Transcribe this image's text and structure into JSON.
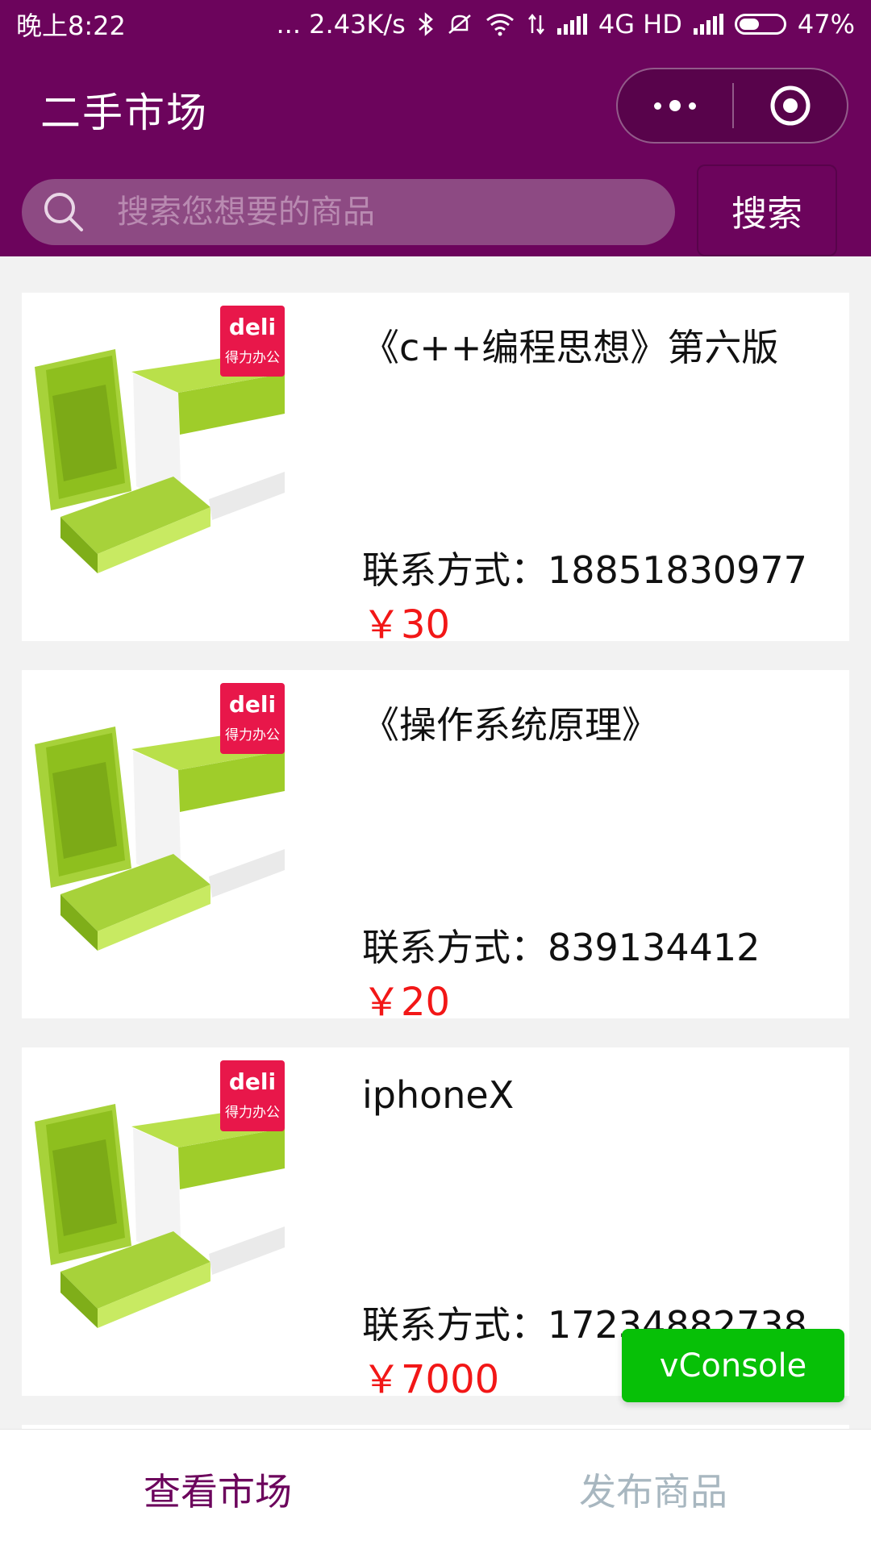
{
  "status_bar": {
    "time": "晚上8:22",
    "net_speed": "... 2.43K/s",
    "network_label": "4G HD",
    "battery": "47%",
    "battery_level": 0.47
  },
  "header": {
    "title": "二手市场",
    "search": {
      "placeholder": "搜索您想要的商品",
      "button_label": "搜索"
    }
  },
  "products": [
    {
      "title": "《c++编程思想》第六版",
      "contact": "联系方式：18851830977",
      "price": "￥30",
      "image": "deli-a4-paper-product-photo"
    },
    {
      "title": "《操作系统原理》",
      "contact": "联系方式：839134412",
      "price": "￥20",
      "image": "deli-a4-paper-product-photo"
    },
    {
      "title": "iphoneX",
      "contact": "联系方式：17234882738",
      "price": "￥7000",
      "image": "deli-a4-paper-product-photo"
    }
  ],
  "brand_badge": {
    "line1": "deli",
    "line2": "得力办公",
    "color": "#e8174a"
  },
  "vconsole_label": "vConsole",
  "tabs": [
    {
      "label": "查看市场",
      "active": true
    },
    {
      "label": "发布商品",
      "active": false
    }
  ],
  "colors": {
    "brand": "#6c045c",
    "price": "#f21717",
    "vconsole": "#07c007",
    "tab_inactive": "#a8b7c0"
  }
}
